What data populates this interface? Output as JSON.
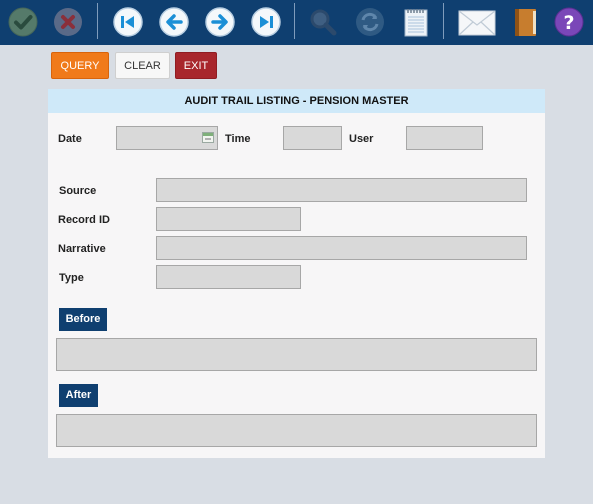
{
  "toolbar": {
    "icons": [
      "check-icon",
      "cancel-icon",
      "first-record-icon",
      "previous-record-icon",
      "next-record-icon",
      "last-record-icon",
      "search-icon",
      "refresh-icon",
      "notepad-icon",
      "mail-icon",
      "book-icon",
      "help-icon"
    ]
  },
  "actions": {
    "query_label": "QUERY",
    "clear_label": "CLEAR",
    "exit_label": "EXIT"
  },
  "panel": {
    "title": "AUDIT TRAIL LISTING - PENSION MASTER",
    "date_label": "Date",
    "date_value": "",
    "time_label": "Time",
    "time_value": "",
    "user_label": "User",
    "user_value": "",
    "source_label": "Source",
    "source_value": "",
    "record_id_label": "Record ID",
    "record_id_value": "",
    "narrative_label": "Narrative",
    "narrative_value": "",
    "type_label": "Type",
    "type_value": "",
    "before_label": "Before",
    "before_value": "",
    "after_label": "After",
    "after_value": ""
  },
  "colors": {
    "toolbar_bg": "#0f3f70",
    "query_button": "#f07a1a",
    "exit_button": "#a8262c",
    "header_bg": "#cfe9f9",
    "field_bg": "#d9d9d9"
  }
}
